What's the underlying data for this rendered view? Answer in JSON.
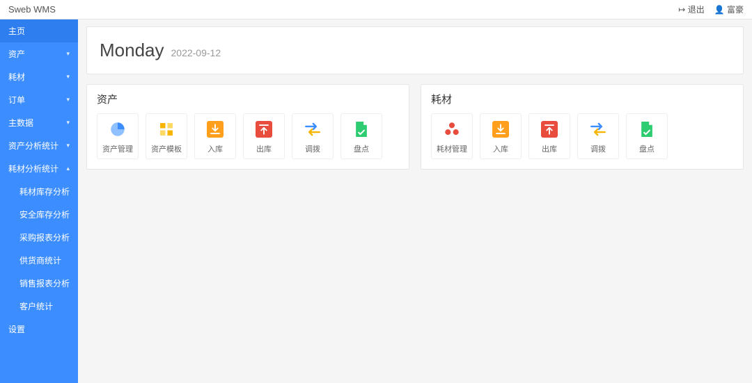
{
  "app": {
    "title": "Sweb WMS"
  },
  "header": {
    "logout": "退出",
    "user": "富豪"
  },
  "sidebar": {
    "items": [
      {
        "label": "主页",
        "chev": ""
      },
      {
        "label": "资产",
        "chev": "▾"
      },
      {
        "label": "耗材",
        "chev": "▾"
      },
      {
        "label": "订单",
        "chev": "▾"
      },
      {
        "label": "主数据",
        "chev": "▾"
      },
      {
        "label": "资产分析统计",
        "chev": "▾"
      },
      {
        "label": "耗材分析统计",
        "chev": "▴"
      },
      {
        "label": "设置",
        "chev": ""
      }
    ],
    "sub": [
      {
        "label": "耗材库存分析"
      },
      {
        "label": "安全库存分析"
      },
      {
        "label": "采购报表分析"
      },
      {
        "label": "供货商统计"
      },
      {
        "label": "销售报表分析"
      },
      {
        "label": "客户统计"
      }
    ]
  },
  "main": {
    "weekday": "Monday",
    "date": "2022-09-12",
    "panels": {
      "assets": {
        "title": "资产",
        "cards": [
          {
            "label": "资产管理"
          },
          {
            "label": "资产模板"
          },
          {
            "label": "入库"
          },
          {
            "label": "出库"
          },
          {
            "label": "调拨"
          },
          {
            "label": "盘点"
          }
        ]
      },
      "consumables": {
        "title": "耗材",
        "cards": [
          {
            "label": "耗材管理"
          },
          {
            "label": "入库"
          },
          {
            "label": "出库"
          },
          {
            "label": "调拨"
          },
          {
            "label": "盘点"
          }
        ]
      }
    }
  }
}
